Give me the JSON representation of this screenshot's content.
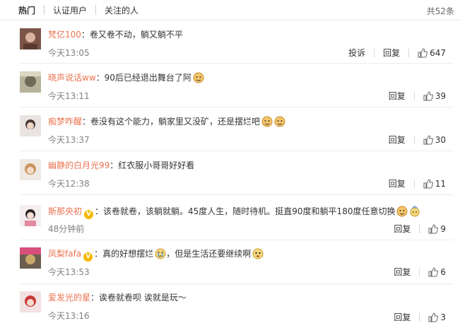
{
  "tabs": {
    "hot": "热门",
    "verified": "认证用户",
    "following": "关注的人"
  },
  "total": "共52条",
  "actions": {
    "report": "投诉",
    "reply": "回复"
  },
  "comments": [
    {
      "user": "梵亿100",
      "text": "：卷又卷不动，躺又躺不平",
      "time": "今天13:05",
      "likes": "647",
      "has_report": true
    },
    {
      "user": "晓声说话ww",
      "text": "：90后已经退出舞台了阿",
      "time": "今天13:11",
      "likes": "39"
    },
    {
      "user": "痴梦咋醒",
      "text": "：卷没有这个能力，躺家里又没矿，还是摆烂吧",
      "time": "今天13:37",
      "likes": "30"
    },
    {
      "user": "幽静的白月光99",
      "text": "：红衣服小哥哥好好看",
      "time": "今天12:38",
      "likes": "11"
    },
    {
      "user": "斯那央初",
      "text": "：该卷就卷，该躺就躺。45度人生，随时待机。挺直90度和躺平180度任意切换",
      "time": "48分钟前",
      "likes": "9",
      "verified": true
    },
    {
      "user": "凤梨fafa",
      "text1": "：真的好想摆烂",
      "text2": "，但是生活还要继续啊",
      "time": "今天13:53",
      "likes": "6",
      "verified": true
    },
    {
      "user": "爱发光的星",
      "text": "：诶卷就卷呗 诶就是玩～",
      "time": "今天13:16",
      "likes": "3"
    }
  ],
  "colors": {
    "username": "#eb7350",
    "time": "#808080",
    "badge": "#f5b800"
  }
}
